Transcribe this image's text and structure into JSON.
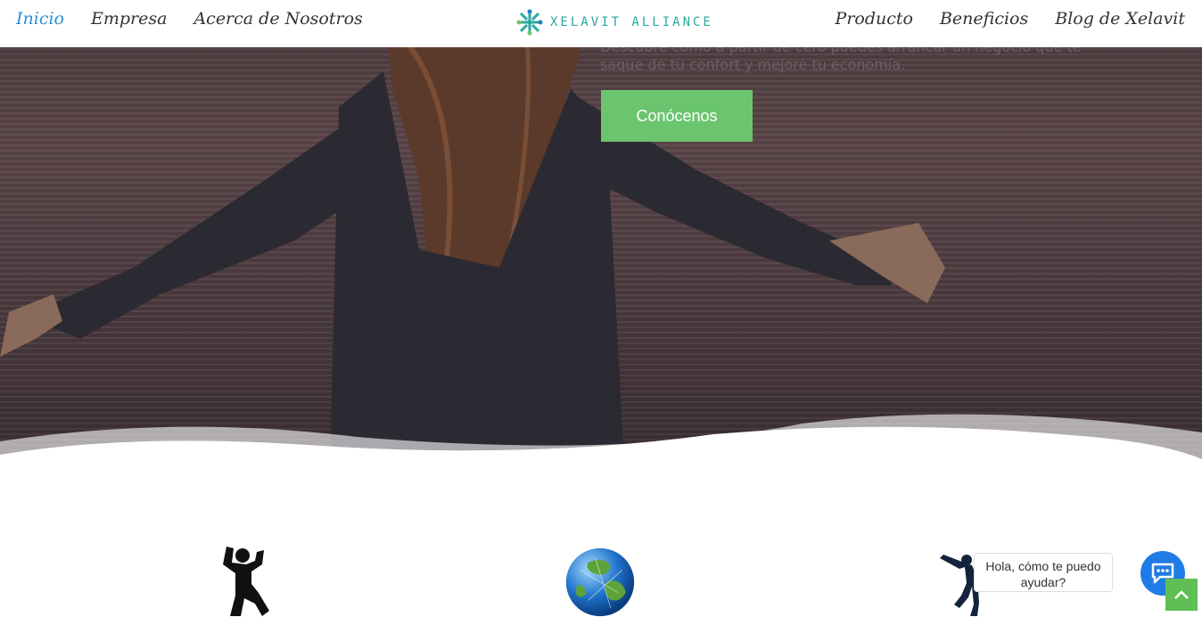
{
  "nav": {
    "left": [
      "Inicio",
      "Empresa",
      "Acerca de Nosotros"
    ],
    "right": [
      "Producto",
      "Beneficios",
      "Blog de Xelavit"
    ]
  },
  "logo": {
    "text": "XELAVIT ALLIANCE"
  },
  "hero": {
    "subtitle": "Descubre cómo a partir de cero puedes arrancar un negocio que te saque de tu confort y mejore tu economía.",
    "cta_label": "Conócenos"
  },
  "chat": {
    "greeting": "Hola, cómo te puedo ayudar?"
  },
  "colors": {
    "accent": "#6bc56f",
    "active_nav": "#2a8fd6",
    "chat": "#1f7ce6",
    "scroll_top": "#5fbf55"
  },
  "icons": [
    "person-kneeling-icon",
    "globe-icon",
    "dancer-icon",
    "chat-icon",
    "arrow-up-icon"
  ]
}
